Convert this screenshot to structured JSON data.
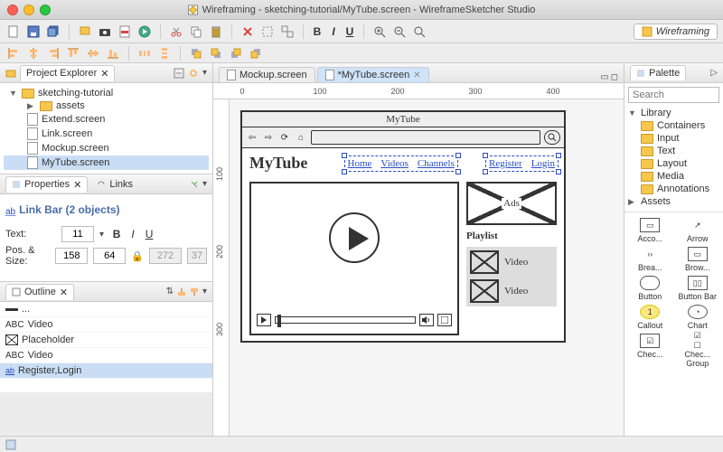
{
  "window_title": "Wireframing - sketching-tutorial/MyTube.screen - WireframeSketcher Studio",
  "perspective": "Wireframing",
  "project_explorer": {
    "title": "Project Explorer",
    "root": "sketching-tutorial",
    "items": [
      "assets",
      "Extend.screen",
      "Link.screen",
      "Mockup.screen",
      "MyTube.screen"
    ],
    "selected": "MyTube.screen"
  },
  "properties": {
    "tab1": "Properties",
    "tab2": "Links",
    "object_label": "Link Bar (2 objects)",
    "text_label": "Text:",
    "font_size": "11",
    "pos_label": "Pos. & Size:",
    "pos_x": "158",
    "pos_y": "64",
    "size_w": "272",
    "size_h": "37"
  },
  "outline": {
    "title": "Outline",
    "items": [
      {
        "icon": "abc",
        "label": "..."
      },
      {
        "icon": "abc",
        "label": "Video"
      },
      {
        "icon": "ph",
        "label": "Placeholder"
      },
      {
        "icon": "abc",
        "label": "Video"
      },
      {
        "icon": "link",
        "label": "Register,Login",
        "selected": true
      }
    ]
  },
  "editor": {
    "tabs": [
      {
        "label": "Mockup.screen",
        "active": false
      },
      {
        "label": "*MyTube.screen",
        "active": true
      }
    ],
    "ruler_marks": [
      0,
      100,
      200,
      300,
      400
    ],
    "vruler_marks": [
      100,
      200,
      300
    ]
  },
  "mockup": {
    "browser_title": "MyTube",
    "logo": "MyTube",
    "nav": [
      "Home",
      "Videos",
      "Channels"
    ],
    "auth": [
      "Register",
      "Login"
    ],
    "ads_label": "Ads",
    "playlist_label": "Playlist",
    "video_label": "Video"
  },
  "palette": {
    "title": "Palette",
    "search_placeholder": "Search",
    "library_label": "Library",
    "categories": [
      "Containers",
      "Input",
      "Text",
      "Layout",
      "Media",
      "Annotations"
    ],
    "assets_label": "Assets",
    "widgets": [
      "Acco...",
      "Arrow",
      "Brea...",
      "Brow...",
      "Button",
      "Button Bar",
      "Callout",
      "Chart",
      "Chec...",
      "Chec... Group"
    ]
  }
}
